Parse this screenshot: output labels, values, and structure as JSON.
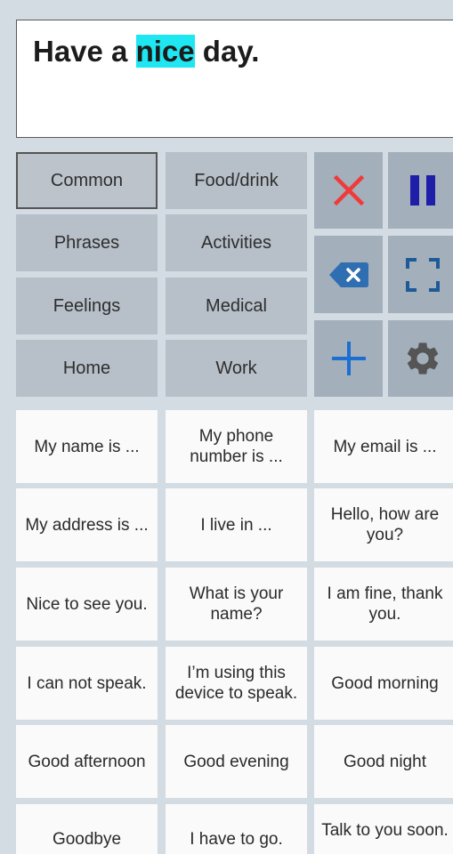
{
  "spoken_text": {
    "before": "Have a ",
    "highlight": "nice",
    "after": " day."
  },
  "categories": [
    "Common",
    "Food/drink",
    "Phrases",
    "Activities",
    "Feelings",
    "Medical",
    "Home",
    "Work"
  ],
  "selected_category": "Common",
  "controls": {
    "clear_icon": "close-icon",
    "pause_icon": "pause-icon",
    "backspace_icon": "backspace-icon",
    "fullscreen_icon": "fullscreen-icon",
    "add_icon": "plus-icon",
    "settings_icon": "gear-icon",
    "colors": {
      "clear": "#f03a3a",
      "pause": "#1e1ea8",
      "backspace": "#2f6fb1",
      "add": "#1c6fd1",
      "settings": "#555555"
    }
  },
  "phrases": [
    [
      "My name is ...",
      "My phone number is ...",
      "My email is ..."
    ],
    [
      "My address is ...",
      "I live in ...",
      "Hello, how are you?"
    ],
    [
      "Nice to see you.",
      "What is your name?",
      "I am fine, thank you."
    ],
    [
      "I can not speak.",
      "I’m using this device to speak.",
      "Good morning"
    ],
    [
      "Good afternoon",
      "Good evening",
      "Good night"
    ],
    [
      "Goodbye",
      "I have to go.",
      "Talk to you soon."
    ]
  ]
}
